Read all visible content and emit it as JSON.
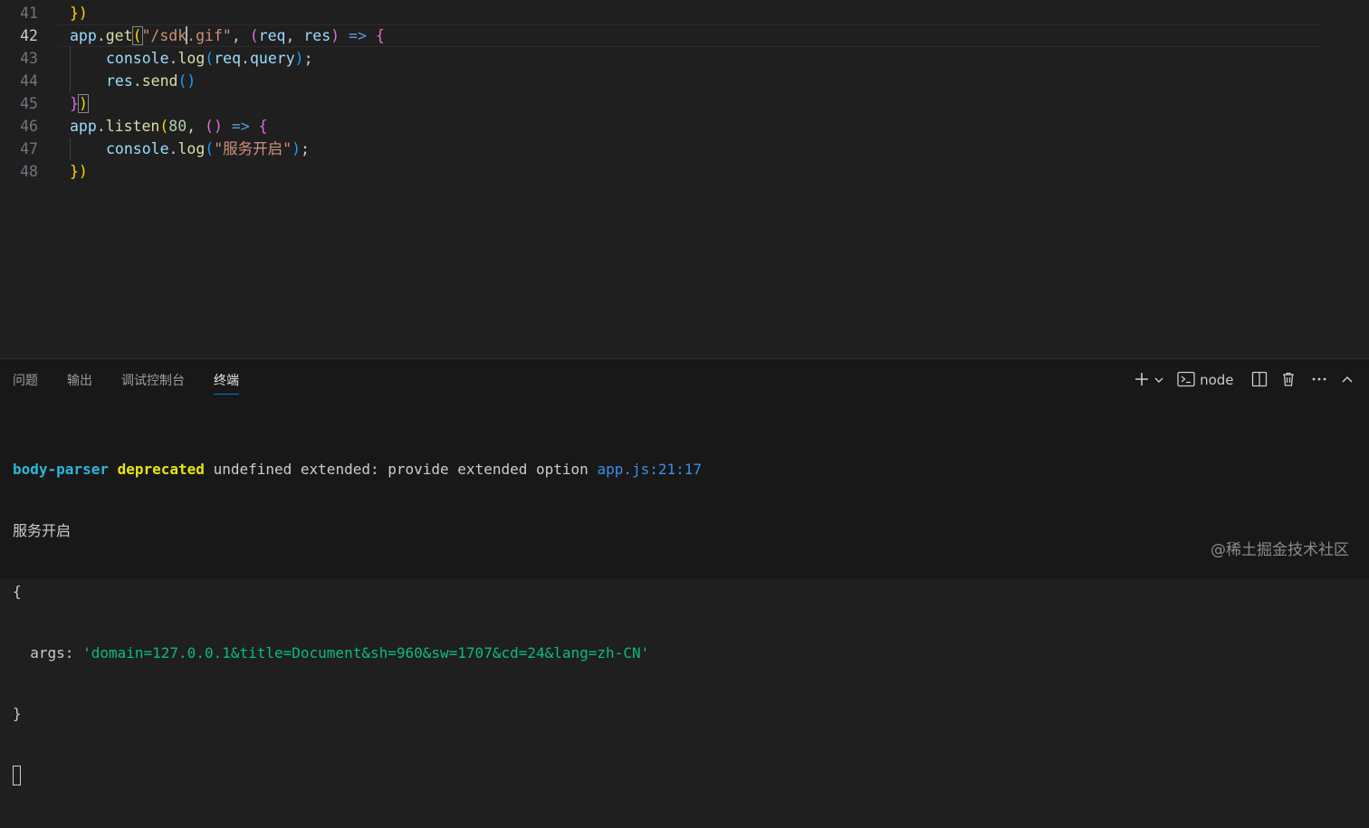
{
  "editor": {
    "lines": [
      {
        "num": "41"
      },
      {
        "num": "42"
      },
      {
        "num": "43"
      },
      {
        "num": "44"
      },
      {
        "num": "45"
      },
      {
        "num": "46"
      },
      {
        "num": "47"
      },
      {
        "num": "48"
      }
    ],
    "tokens": {
      "l41_close": "})",
      "l42_app": "app",
      "l42_dot": ".",
      "l42_get": "get",
      "l42_paren_open": "(",
      "l42_str_a": "\"/sdk",
      "l42_str_b": ".gif\"",
      "l42_comma": ",",
      "l42_args_open": "(",
      "l42_req": "req",
      "l42_comma2": ",",
      "l42_res": "res",
      "l42_args_close": ")",
      "l42_arrow": "=>",
      "l42_brace": "{",
      "l43_console": "console",
      "l43_dot": ".",
      "l43_log": "log",
      "l43_open": "(",
      "l43_req": "req",
      "l43_dot2": ".",
      "l43_query": "query",
      "l43_close": ")",
      "l43_semi": ";",
      "l44_res": "res",
      "l44_dot": ".",
      "l44_send": "send",
      "l44_parens": "()",
      "l45_brace": "}",
      "l45_paren": ")",
      "l46_app": "app",
      "l46_dot": ".",
      "l46_listen": "listen",
      "l46_open": "(",
      "l46_num": "80",
      "l46_comma": ",",
      "l46_parens": "()",
      "l46_arrow": "=>",
      "l46_brace": "{",
      "l47_console": "console",
      "l47_dot": ".",
      "l47_log": "log",
      "l47_open": "(",
      "l47_str": "\"服务开启\"",
      "l47_close": ")",
      "l47_semi": ";",
      "l48_close": "})"
    }
  },
  "panel": {
    "tabs": [
      {
        "label": "问题"
      },
      {
        "label": "输出"
      },
      {
        "label": "调试控制台"
      },
      {
        "label": "终端",
        "active": true
      }
    ],
    "actions": {
      "add_icon": "plus-icon",
      "dropdown_icon": "chevron-down-icon",
      "terminal_name": "node",
      "split_icon": "split-icon",
      "trash_icon": "trash-icon",
      "more_icon": "more-icon",
      "maximize_icon": "chevron-up-icon"
    }
  },
  "terminal": {
    "line1": {
      "module": "body-parser",
      "level": "deprecated",
      "message": "undefined extended: provide extended option",
      "location": "app.js:21:17"
    },
    "line2": "服务开启",
    "line3": "{",
    "line4": {
      "key": "args:",
      "value": "'domain=127.0.0.1&title=Document&sh=960&sw=1707&cd=24&lang=zh-CN'"
    },
    "line5": "}"
  },
  "watermark": "@稀土掘金技术社区",
  "colors": {
    "background": "#1f1f1f",
    "panel_background": "#181818",
    "accent": "#0078d4",
    "string": "#ce9178",
    "variable": "#9cdcfe",
    "function": "#dcdcaa",
    "terminal_green": "#0dbc79"
  }
}
